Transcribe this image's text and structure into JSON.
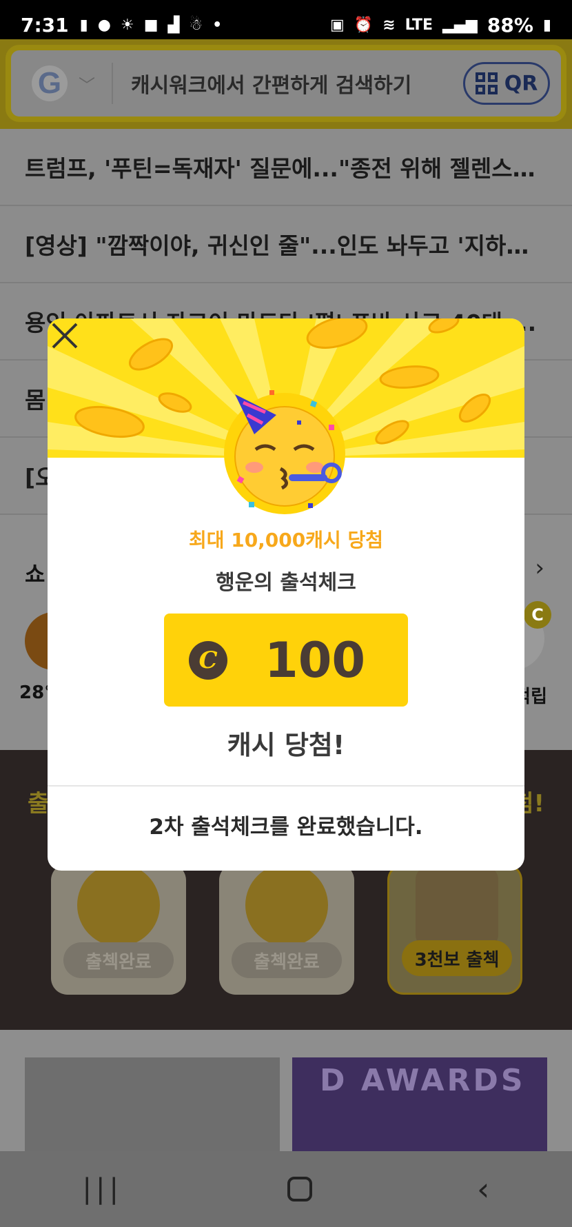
{
  "status_bar": {
    "time": "7:31",
    "network": "LTE",
    "battery": "88%"
  },
  "search": {
    "placeholder": "캐시워크에서 간편하게 검색하기",
    "engine_icon": "google-logo",
    "qr_label": "QR"
  },
  "news": [
    "트럼프, '푸틴=독재자' 질문에...\"종전 위해 젤렌스키·...",
    "[영상] \"깜짝이야, 귀신인 줄\"...인도 놔두고 '지하차...",
    "용인 아파트서 자고이 마드다 '평' 포바 사고 40대 ...",
    "몸",
    "[오"
  ],
  "shop": {
    "title": "쇼",
    "left_caption": "28°",
    "right_badge": "C",
    "right_caption": "적립"
  },
  "attendance": {
    "title_left": "출",
    "title_right": "첨!",
    "cards": [
      {
        "label": "출첵완료",
        "active": false
      },
      {
        "label": "출첵완료",
        "active": false
      },
      {
        "label": "3천보 출첵",
        "active": true
      }
    ]
  },
  "thumbnails": {
    "second_text": "D AWARDS"
  },
  "modal": {
    "headline": "최대 10,000캐시 당첨",
    "subtitle": "행운의 출석체크",
    "coin_symbol": "C",
    "amount": "100",
    "result": "캐시 당첨!",
    "footer": "2차 출석체크를 완료했습니다.",
    "emoji": "🥳"
  },
  "colors": {
    "modal_banner": "#ffe01a",
    "cash_box": "#ffd20a",
    "headline": "#f7a81b",
    "coin_dark": "#4a3c34"
  }
}
